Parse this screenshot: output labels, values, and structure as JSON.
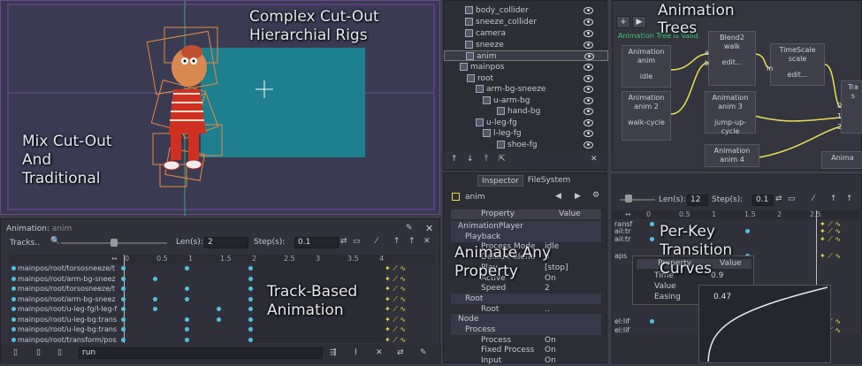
{
  "overlay": {
    "complex_rigs": [
      "Complex Cut-Out",
      "Hierarchial Rigs"
    ],
    "mix_cutout": [
      "Mix Cut-Out",
      "And",
      "Traditional"
    ],
    "track_based": [
      "Track-Based",
      "Animation"
    ],
    "animate_any": [
      "Animate Any",
      "Property"
    ],
    "animation_trees": [
      "Animation",
      "Trees"
    ],
    "per_key": [
      "Per-Key",
      "Transition",
      "Curves"
    ]
  },
  "scene_tree": {
    "items": [
      {
        "label": "body_collider"
      },
      {
        "label": "sneeze_collider"
      },
      {
        "label": "camera"
      },
      {
        "label": "sneeze"
      },
      {
        "label": "anim"
      },
      {
        "label": "mainpos"
      },
      {
        "label": "root"
      },
      {
        "label": "arm-bg-sneeze"
      },
      {
        "label": "u-arm-bg"
      },
      {
        "label": "hand-bg"
      },
      {
        "label": "u-leg-fg"
      },
      {
        "label": "l-leg-fg"
      },
      {
        "label": "shoe-fg"
      }
    ]
  },
  "inspector": {
    "tabs": [
      "Inspector",
      "FileSystem"
    ],
    "node_name": "anim",
    "header_property": "Property",
    "header_value": "Value",
    "rows": [
      {
        "label": "AnimationPlayer",
        "value": ""
      },
      {
        "label": "Playback",
        "value": ""
      },
      {
        "label": "Process Mode",
        "value": "idle"
      },
      {
        "label": "Default Blend",
        "value": "0"
      },
      {
        "label": "Play",
        "value": "[stop]"
      },
      {
        "label": "Active",
        "value": "On"
      },
      {
        "label": "Speed",
        "value": "2"
      },
      {
        "label": "Root",
        "value": ""
      },
      {
        "label": "Root",
        "value": ".."
      },
      {
        "label": "Node",
        "value": ""
      },
      {
        "label": "Process",
        "value": ""
      },
      {
        "label": "Process",
        "value": "On"
      },
      {
        "label": "Fixed Process",
        "value": "On"
      },
      {
        "label": "Input",
        "value": "On"
      }
    ]
  },
  "anim_tree": {
    "status": "Animation Tree is Valid.",
    "nodes": [
      {
        "title": "Animation",
        "sub": "anim",
        "value": "idle"
      },
      {
        "title": "Blend2",
        "sub": "walk",
        "value": "edit..."
      },
      {
        "title": "TimeScale",
        "sub": "scale",
        "value": "edit..."
      },
      {
        "title": "Animation",
        "sub": "anim 2",
        "value": "walk-cycle"
      },
      {
        "title": "Animation",
        "sub": "anim 3",
        "value": "jump-up-cycle"
      },
      {
        "title": "Animation",
        "sub": "anim 4",
        "value": ""
      },
      {
        "title": "Tra",
        "sub": "s",
        "value": ""
      },
      {
        "title": "Anima",
        "sub": "",
        "value": ""
      }
    ],
    "ports": {
      "a": "a",
      "b": "b",
      "in": "in",
      "p0": "0",
      "p1": "1",
      "p2": "2"
    }
  },
  "anim_panel": {
    "title": "Animation:",
    "anim_name": "anim",
    "tracks_label": "Tracks..",
    "len_label": "Len(s):",
    "len_value": "2",
    "step_label": "Step(s):",
    "step_value": "0.1",
    "ruler": [
      "0",
      "0.5",
      "1",
      "1.5",
      "2",
      "2.5",
      "3",
      "3.5",
      "4"
    ],
    "tracks": [
      "mainpos/root/torsosneeze/t",
      "mainpos/root/arm-bg-sneez",
      "mainpos/root/torsosneeze/t",
      "mainpos/root/arm-bg-sneez",
      "mainpos/root/u-leg-fg/l-leg-f",
      "mainpos/root/u-leg-bg:trans",
      "mainpos/root/u-leg-bg:trans",
      "mainpos/root/transform/pos"
    ],
    "bottom_anim": "run"
  },
  "anim_panel2": {
    "len_label": "Len(s):",
    "len_value": "12",
    "step_label": "Step(s):",
    "step_value": "0.1",
    "ruler": [
      "0",
      "0.5",
      "1",
      "1.5",
      "2",
      "2.5"
    ],
    "tracks": [
      "ransf",
      "ail:tr",
      "ail:tr",
      "aps",
      "el:lif",
      "el:lif"
    ]
  },
  "curve_popup": {
    "header_property": "Property",
    "header_value": "Value",
    "rows": [
      {
        "label": "Time",
        "value": "0.9"
      },
      {
        "label": "Value",
        "value": ""
      },
      {
        "label": "Easing",
        "value": ""
      }
    ],
    "easing_value": "0.47"
  },
  "colors": {
    "accent_dot": "#4cc4dc",
    "key_yellow": "#e8e040",
    "viewport_blue": "#1e7f8e"
  }
}
